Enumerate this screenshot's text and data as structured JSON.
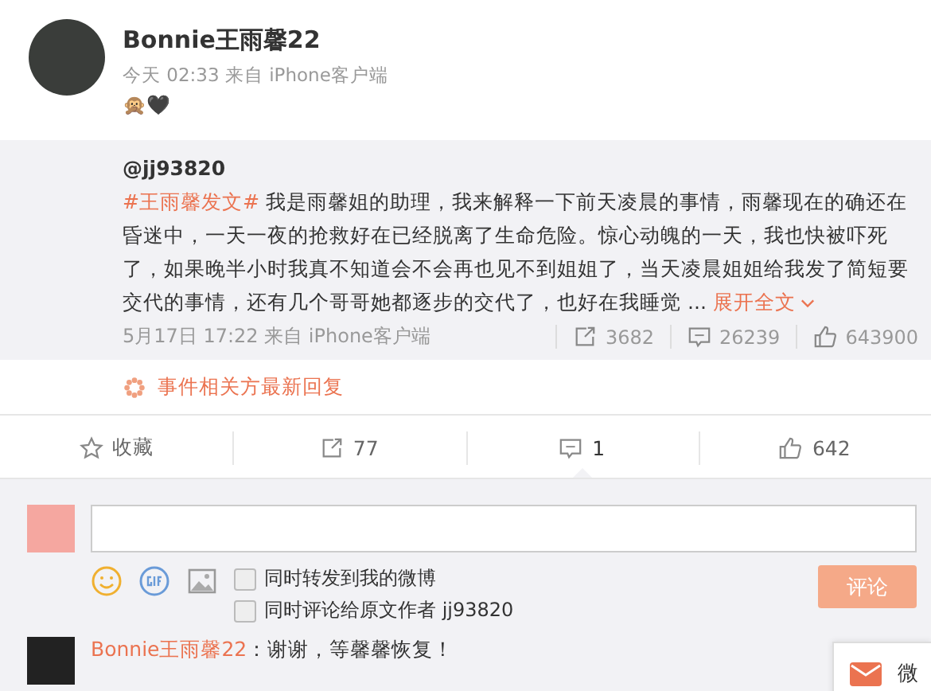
{
  "post": {
    "author": "Bonnie王雨馨22",
    "time": "今天 02:33 来自 iPhone客户端",
    "emoji": "🙊🖤",
    "repost": {
      "user": "@jj93820",
      "hashtag": "#王雨馨发文#",
      "text": " 我是雨馨姐的助理，我来解释一下前天凌晨的事情，雨馨现在的确还在昏迷中，一天一夜的抢救好在已经脱离了生命危险。惊心动魄的一天，我也快被吓死了，如果晚半小时我真不知道会不会再也见不到姐姐了，当天凌晨姐姐给我发了简短要交代的事情，还有几个哥哥她都逐步的交代了，也好在我睡觉 ... ",
      "expand": "展开全文",
      "time": "5月17日 17:22 来自 iPhone客户端",
      "reposts": "3682",
      "comments": "26239",
      "likes": "643900"
    },
    "related": "事件相关方最新回复"
  },
  "actions": [
    {
      "kind": "star",
      "label": "收藏",
      "selected": false
    },
    {
      "kind": "repost",
      "label": "77",
      "selected": false
    },
    {
      "kind": "comment",
      "label": "1",
      "selected": true
    },
    {
      "kind": "like",
      "label": "642",
      "selected": false
    }
  ],
  "composer": {
    "options": [
      {
        "label": "同时转发到我的微博",
        "checked": false
      },
      {
        "label": "同时评论给原文作者 jj93820",
        "checked": false
      }
    ],
    "submit": {
      "label": "评论",
      "disabled": true
    }
  },
  "comments": [
    {
      "author": "Bonnie王雨馨22",
      "text": "：谢谢，等馨馨恢复！"
    }
  ],
  "message_panel": {
    "label": "微"
  }
}
